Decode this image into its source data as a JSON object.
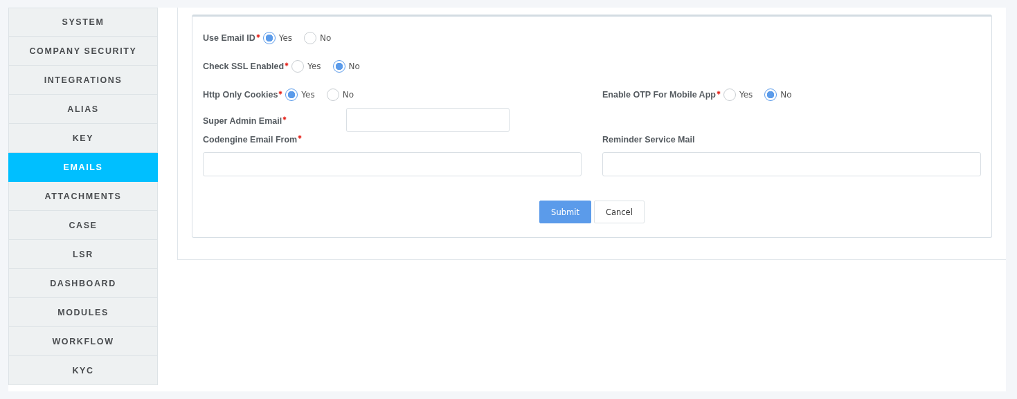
{
  "sidebar": {
    "items": [
      {
        "label": "SYSTEM",
        "selected": false
      },
      {
        "label": "COMPANY SECURITY",
        "selected": false
      },
      {
        "label": "INTEGRATIONS",
        "selected": false
      },
      {
        "label": "ALIAS",
        "selected": false
      },
      {
        "label": "KEY",
        "selected": false
      },
      {
        "label": "EMAILS",
        "selected": true
      },
      {
        "label": "ATTACHMENTS",
        "selected": false
      },
      {
        "label": "CASE",
        "selected": false
      },
      {
        "label": "LSR",
        "selected": false
      },
      {
        "label": "DASHBOARD",
        "selected": false
      },
      {
        "label": "MODULES",
        "selected": false
      },
      {
        "label": "WORKFLOW",
        "selected": false
      },
      {
        "label": "KYC",
        "selected": false
      }
    ]
  },
  "form": {
    "rows": [
      [
        {
          "kind": "radio",
          "label": "Use Email ID",
          "required": true,
          "options": [
            {
              "label": "Yes",
              "selected": true
            },
            {
              "label": "No",
              "selected": false
            }
          ]
        }
      ],
      [
        {
          "kind": "radio",
          "label": "Check SSL Enabled",
          "required": true,
          "options": [
            {
              "label": "Yes",
              "selected": false
            },
            {
              "label": "No",
              "selected": true
            }
          ]
        }
      ],
      [
        {
          "kind": "radio",
          "label": "Http Only Cookies",
          "required": true,
          "options": [
            {
              "label": "Yes",
              "selected": true
            },
            {
              "label": "No",
              "selected": false
            }
          ]
        },
        {
          "kind": "radio",
          "label": "Enable OTP For Mobile App",
          "required": true,
          "options": [
            {
              "label": "Yes",
              "selected": false
            },
            {
              "label": "No",
              "selected": true
            }
          ]
        }
      ],
      [
        {
          "kind": "inline-text",
          "label": "Super Admin Email",
          "required": true
        }
      ],
      [
        {
          "kind": "text",
          "label": "Codengine Email From",
          "required": true
        },
        {
          "kind": "text",
          "label": "Reminder Service Mail",
          "required": false
        }
      ]
    ],
    "buttons": [
      {
        "label": "Submit",
        "kind": "primary"
      },
      {
        "label": "Cancel",
        "kind": "secondary"
      }
    ]
  }
}
